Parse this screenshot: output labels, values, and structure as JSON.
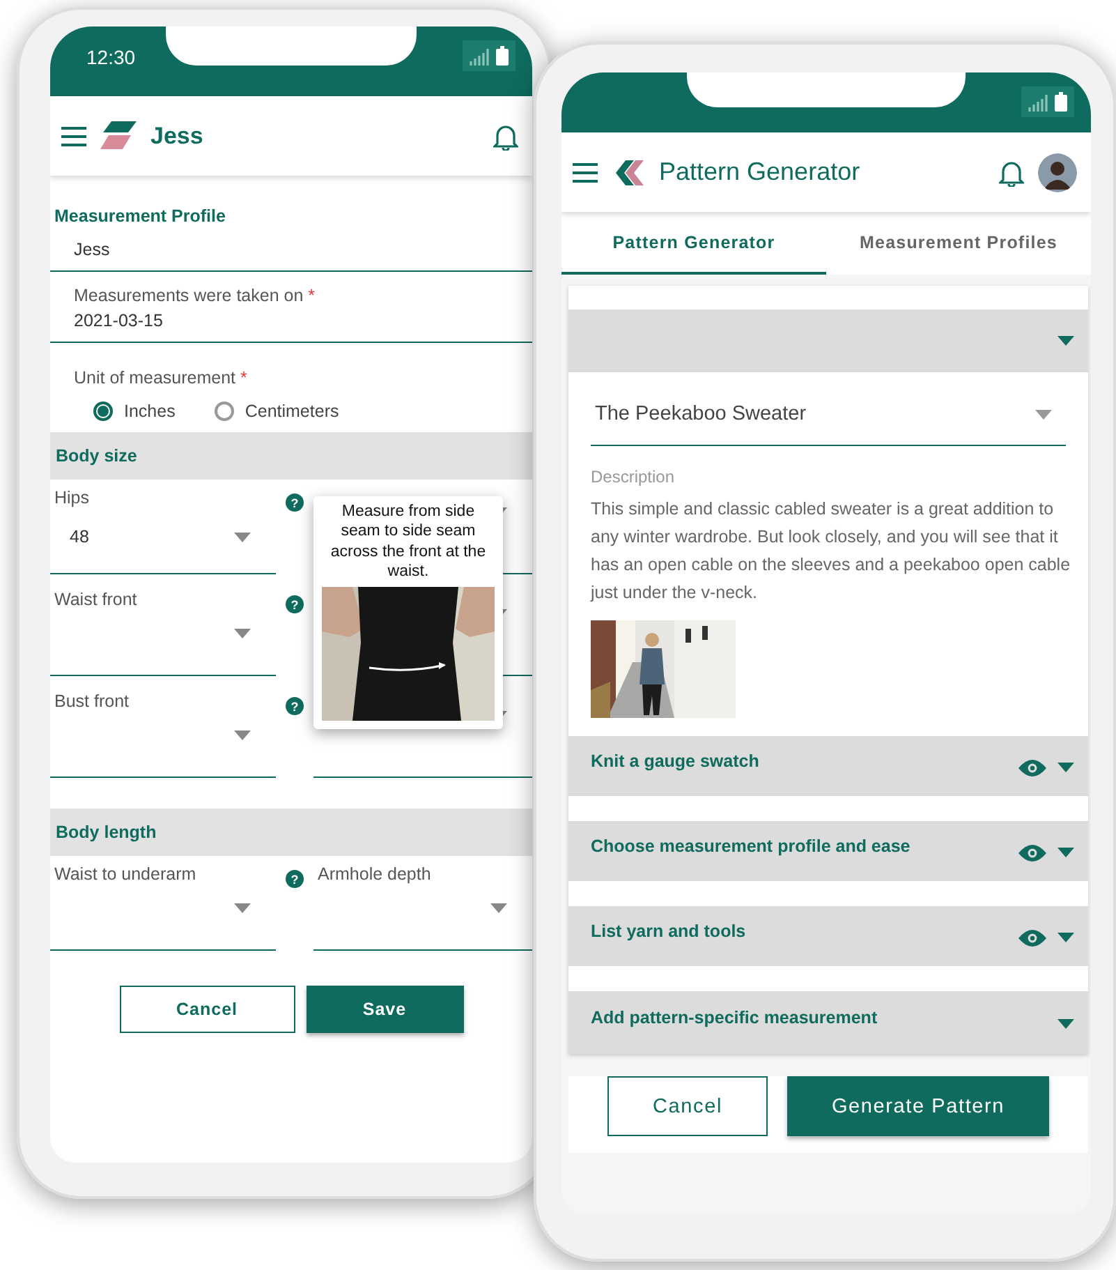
{
  "left_phone": {
    "status_bar": {
      "time": "12:30"
    },
    "app_bar": {
      "title": "Jess"
    },
    "profile": {
      "heading": "Measurement Profile",
      "name_field": {
        "value": "Jess"
      },
      "date_field": {
        "label": "Measurements were taken on",
        "mark": "*",
        "value": "2021-03-15"
      },
      "unit_field": {
        "label": "Unit of measurement",
        "mark": "*",
        "options": [
          {
            "label": "Inches",
            "selected": true
          },
          {
            "label": "Centimeters",
            "selected": false
          }
        ]
      }
    },
    "sections": [
      {
        "title": "Body size",
        "fields": [
          {
            "kind": "select",
            "label": "Hips",
            "value": "48",
            "help": "?"
          },
          {
            "kind": "select"
          },
          {
            "kind": "select",
            "label": "Waist front",
            "help": "?"
          },
          {
            "kind": "select"
          },
          {
            "kind": "select",
            "label": "Bust front",
            "help": "?"
          },
          {
            "kind": "select"
          }
        ]
      },
      {
        "title": "Body length",
        "fields": [
          {
            "kind": "select",
            "label": "Waist to underarm",
            "help": "?"
          },
          {
            "kind": "select",
            "label": "Armhole depth"
          }
        ]
      }
    ],
    "tooltip": {
      "text": "Measure from side seam to side seam across the front at the waist."
    },
    "buttons": [
      {
        "label": "Cancel",
        "kind": "outlined"
      },
      {
        "label": "Save",
        "kind": "filled"
      }
    ]
  },
  "right_phone": {
    "app_bar": {
      "title": "Pattern Generator"
    },
    "tabs": [
      {
        "label": "Pattern Generator",
        "selected": true
      },
      {
        "label": "Measurement Profiles",
        "selected": false
      }
    ],
    "pattern_select": {
      "value": "The Peekaboo Sweater"
    },
    "description": {
      "label": "Description",
      "text": "This simple and classic cabled sweater is a great addition to any winter wardrobe. But look closely, and you will see that it has an open cable on the sleeves and a peekaboo open cable just under the v-neck."
    },
    "steps": [
      {
        "title": "Knit a gauge swatch",
        "viewable": true
      },
      {
        "title": "Choose measurement profile and ease",
        "viewable": true
      },
      {
        "title": "List yarn and tools",
        "viewable": true
      },
      {
        "title": "Add pattern-specific measurement",
        "viewable": false
      }
    ],
    "buttons": [
      {
        "label": "Cancel",
        "kind": "outlined"
      },
      {
        "label": "Generate Pattern",
        "kind": "filled"
      }
    ]
  }
}
